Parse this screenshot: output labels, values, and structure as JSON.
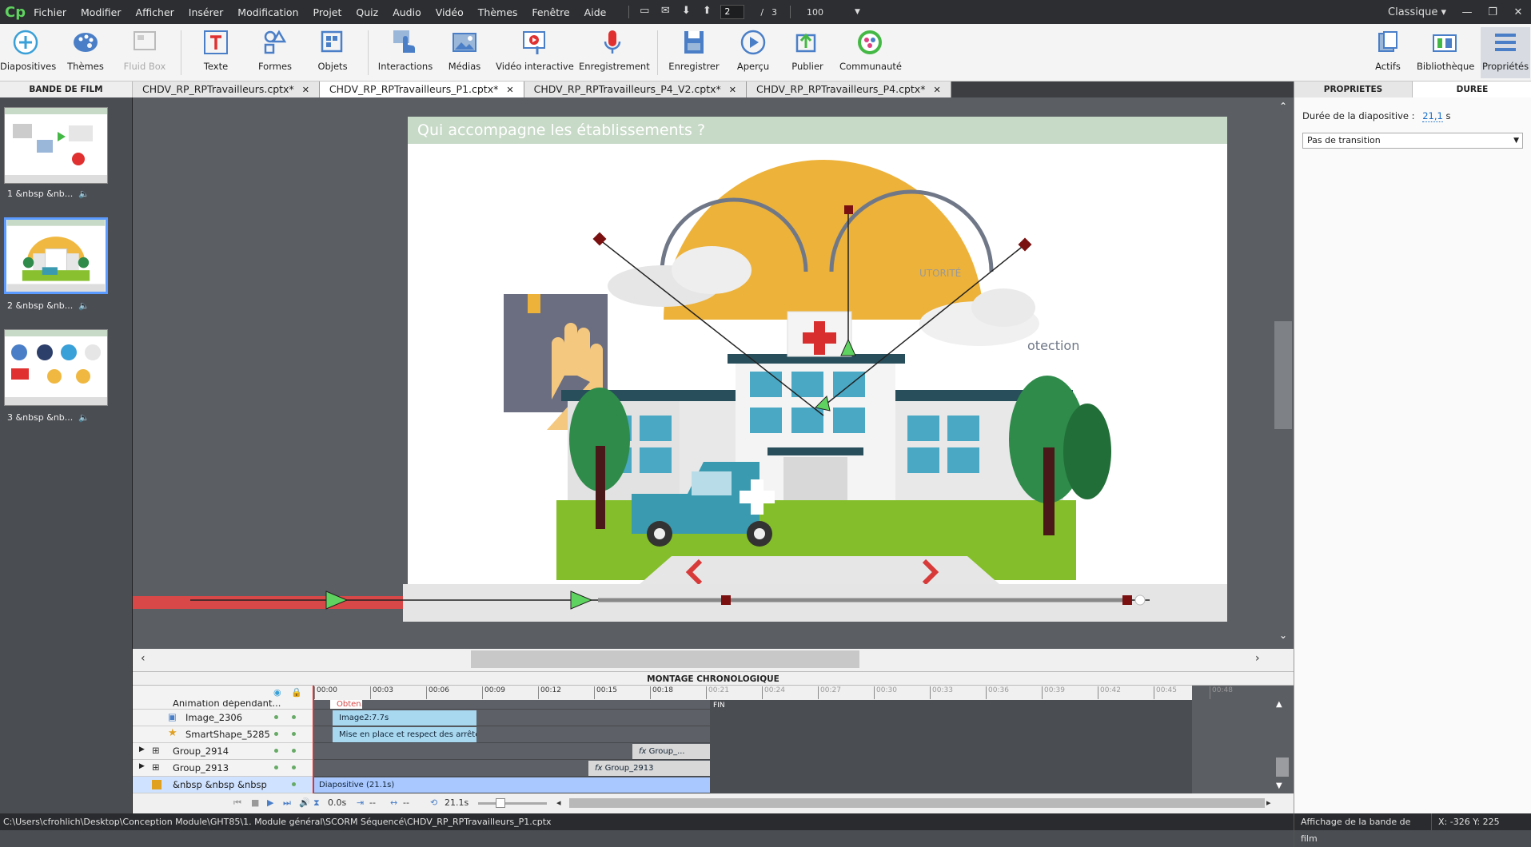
{
  "app": {
    "logo": "Cp"
  },
  "menu": [
    "Fichier",
    "Modifier",
    "Afficher",
    "Insérer",
    "Modification",
    "Projet",
    "Quiz",
    "Audio",
    "Vidéo",
    "Thèmes",
    "Fenêtre",
    "Aide"
  ],
  "pager": {
    "current": "2",
    "separator": "/",
    "total": "3",
    "zoom": "100"
  },
  "workspace": {
    "label": "Classique"
  },
  "toolbar": {
    "slides": "Diapositives",
    "themes": "Thèmes",
    "fluidbox": "Fluid Box",
    "text": "Texte",
    "shapes": "Formes",
    "objects": "Objets",
    "interactions": "Interactions",
    "media": "Médias",
    "interactive_video": "Vidéo interactive",
    "record": "Enregistrement",
    "save": "Enregistrer",
    "preview": "Aperçu",
    "publish": "Publier",
    "community": "Communauté",
    "assets": "Actifs",
    "library": "Bibliothèque",
    "properties": "Propriétés"
  },
  "filmstrip": {
    "title": "BANDE DE FILM",
    "slides": [
      {
        "label": "1 &nbsp &nb..."
      },
      {
        "label": "2 &nbsp &nb..."
      },
      {
        "label": "3 &nbsp &nb..."
      }
    ]
  },
  "tabs": [
    {
      "label": "CHDV_RP_RPTravailleurs.cptx*"
    },
    {
      "label": "CHDV_RP_RPTravailleurs_P1.cptx*"
    },
    {
      "label": "CHDV_RP_RPTravailleurs_P4_V2.cptx*"
    },
    {
      "label": "CHDV_RP_RPTravailleurs_P4.cptx*"
    }
  ],
  "slide": {
    "title": "Qui accompagne les établissements ?",
    "text_partial": "otection",
    "text_partial2": "UTORITÉ"
  },
  "timeline": {
    "title": "MONTAGE CHRONOLOGIQUE",
    "ruler": [
      "00:00",
      "00:03",
      "00:06",
      "00:09",
      "00:12",
      "00:15",
      "00:18",
      "00:21",
      "00:24",
      "00:27",
      "00:30",
      "00:33",
      "00:36",
      "00:39",
      "00:42",
      "00:45",
      "00:48"
    ],
    "end_label": "FIN",
    "rows": [
      {
        "name": "Animation dépendant...",
        "bar": "Obten..."
      },
      {
        "name": "Image_2306",
        "bar": "Image2:7.7s"
      },
      {
        "name": "SmartShape_5285",
        "bar": "Mise en place et respect des arrêtés ..."
      },
      {
        "name": "Group_2914",
        "bar": "Group_..."
      },
      {
        "name": "Group_2913",
        "bar": "Group_2913"
      },
      {
        "name": "&nbsp &nbsp &nbsp Qui ...",
        "bar": "Diapositive (21.1s)"
      }
    ],
    "footer": {
      "start": "0.0s",
      "mid": "--",
      "mid2": "--",
      "duration": "21.1s"
    }
  },
  "properties": {
    "tab_props": "PROPRIETES",
    "tab_duration": "DUREE",
    "duration_label": "Durée de la diapositive :",
    "duration_value": "21,1",
    "duration_unit": "s",
    "transition": "Pas de transition"
  },
  "status": {
    "path": "C:\\Users\\cfrohlich\\Desktop\\Conception Module\\GHT85\\1. Module général\\SCORM Séquencé\\CHDV_RP_RPTravailleurs_P1.cptx",
    "view": "Affichage de la bande de film",
    "coords": "X: -326 Y: 225"
  }
}
